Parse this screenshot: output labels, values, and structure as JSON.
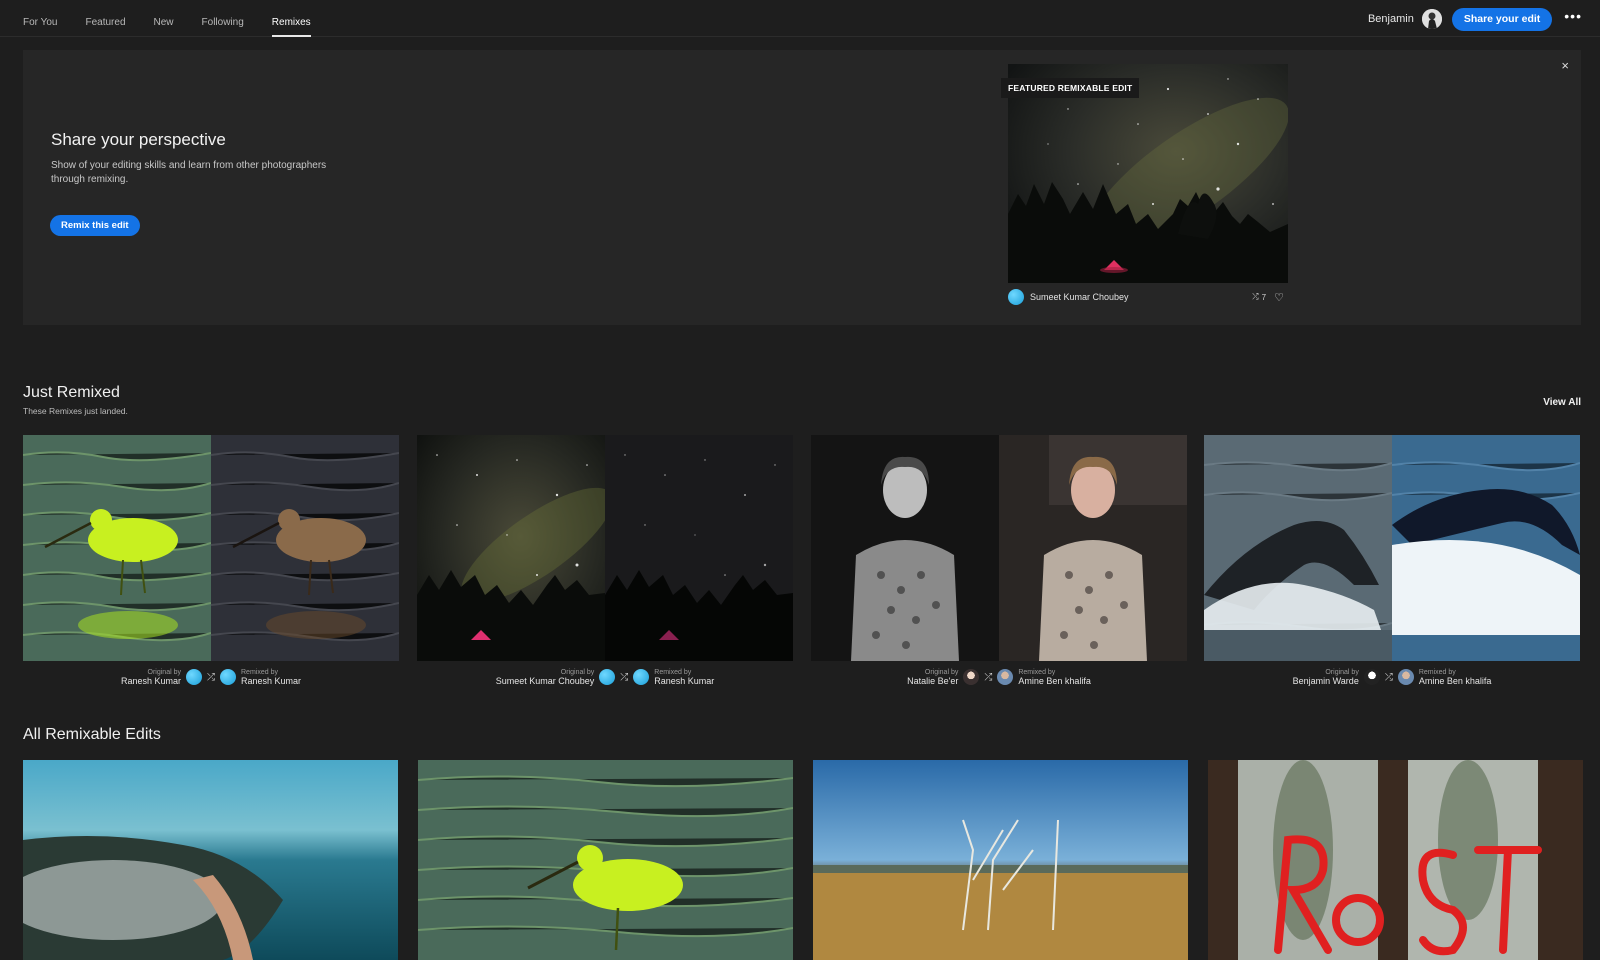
{
  "nav": {
    "tabs": [
      "For You",
      "Featured",
      "New",
      "Following",
      "Remixes"
    ],
    "active_tab": "Remixes",
    "username": "Benjamin",
    "share_label": "Share your edit",
    "more_label": "•••"
  },
  "hero": {
    "title": "Share your perspective",
    "description": "Show of your editing skills and learn from other photographers through remixing.",
    "button_label": "Remix this edit",
    "close_label": "×",
    "badge": "FEATURED REMIXABLE EDIT",
    "author": "Sumeet Kumar Choubey",
    "remix_count": "7"
  },
  "just_remixed": {
    "title": "Just Remixed",
    "subtitle": "These Remixes just landed.",
    "view_all": "View All",
    "original_label": "Original by",
    "remixed_label": "Remixed by",
    "cards": [
      {
        "original": "Ranesh Kumar",
        "remixed": "Ranesh Kumar"
      },
      {
        "original": "Sumeet Kumar Choubey",
        "remixed": "Ranesh Kumar"
      },
      {
        "original": "Natalie Be'er",
        "remixed": "Amine Ben khalifa"
      },
      {
        "original": "Benjamin Warde",
        "remixed": "Amine Ben khalifa"
      }
    ]
  },
  "all_remixable": {
    "title": "All Remixable Edits"
  },
  "icons": {
    "remix": "remix-icon",
    "heart": "heart-icon",
    "close": "close-icon",
    "more": "more-icon"
  },
  "colors": {
    "accent": "#1473e6",
    "background": "#1e1e1e",
    "hero_bg": "#262626"
  }
}
